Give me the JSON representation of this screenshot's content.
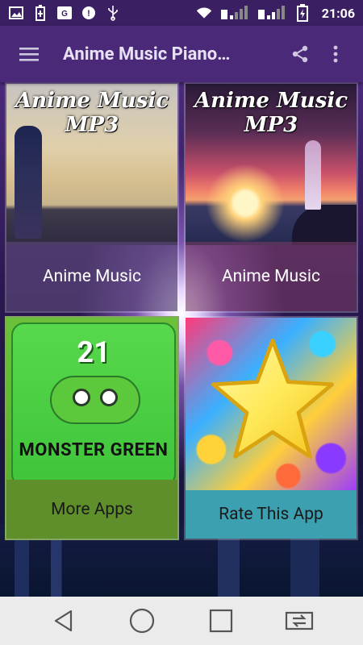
{
  "status_bar": {
    "time": "21:06",
    "icons": [
      "image-icon",
      "battery-saver-icon",
      "cast-icon",
      "notification-icon",
      "usb-icon",
      "wifi-icon",
      "signal-icon",
      "signal-icon",
      "battery-icon"
    ]
  },
  "app_bar": {
    "title": "Anime Music Piano…",
    "menu_icon": "hamburger-menu-icon",
    "share_icon": "share-icon",
    "overflow_icon": "more-vert-icon"
  },
  "cards": [
    {
      "label": "Anime Music",
      "image_text": "Anime Music MP3"
    },
    {
      "label": "Anime Music",
      "image_text": "Anime Music MP3"
    },
    {
      "label": "More Apps",
      "image_text_top": "21",
      "image_text_bottom": "MONSTER GREEN"
    },
    {
      "label": "Rate This App"
    }
  ],
  "nav_bar": {
    "back_icon": "back-icon",
    "home_icon": "home-icon",
    "recents_icon": "recents-icon",
    "switch_icon": "dual-window-icon"
  },
  "colors": {
    "status_bar": "#3b1f63",
    "app_bar": "#4a2a78",
    "nav_bar": "#ebebeb"
  }
}
